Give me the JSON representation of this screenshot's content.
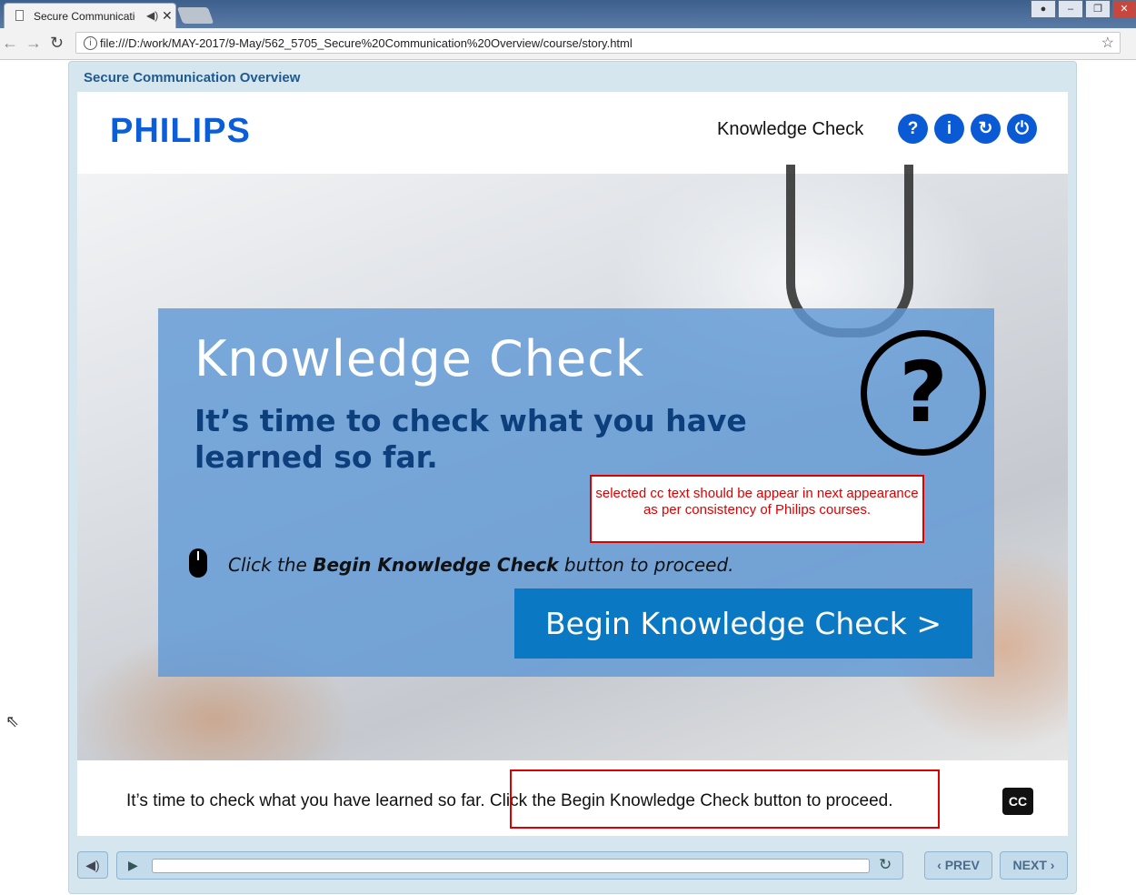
{
  "browser": {
    "tab_title": "Secure Communicatio",
    "tab_close": "✕",
    "url": "file:///D:/work/MAY-2017/9-May/562_5705_Secure%20Communication%20Overview/course/story.html"
  },
  "player": {
    "course_title": "Secure Communication Overview",
    "logo": "PHILIPS",
    "header_title": "Knowledge Check",
    "header_icons": [
      "?",
      "i",
      "↻",
      "⏻"
    ]
  },
  "slide": {
    "heading": "Knowledge Check",
    "subheading": "It’s time to check what you have learned so far.",
    "note": "selected cc text should be appear in next appearance as per consistency of Philips courses.",
    "instruction_pre": "Click the ",
    "instruction_bold": "Begin Knowledge Check",
    "instruction_post": " button to proceed.",
    "begin_button": "Begin Knowledge Check  >"
  },
  "captions": {
    "text": "It’s time to check what you have learned so far. Click the Begin Knowledge Check button to proceed.",
    "cc_label": "CC"
  },
  "controls": {
    "prev": "‹ PREV",
    "next": "NEXT ›",
    "progress": 0
  },
  "colors": {
    "accent": "#0a5ad6",
    "panel": "#6098d6",
    "button": "#0a78c2",
    "highlight": "#dd0000"
  }
}
